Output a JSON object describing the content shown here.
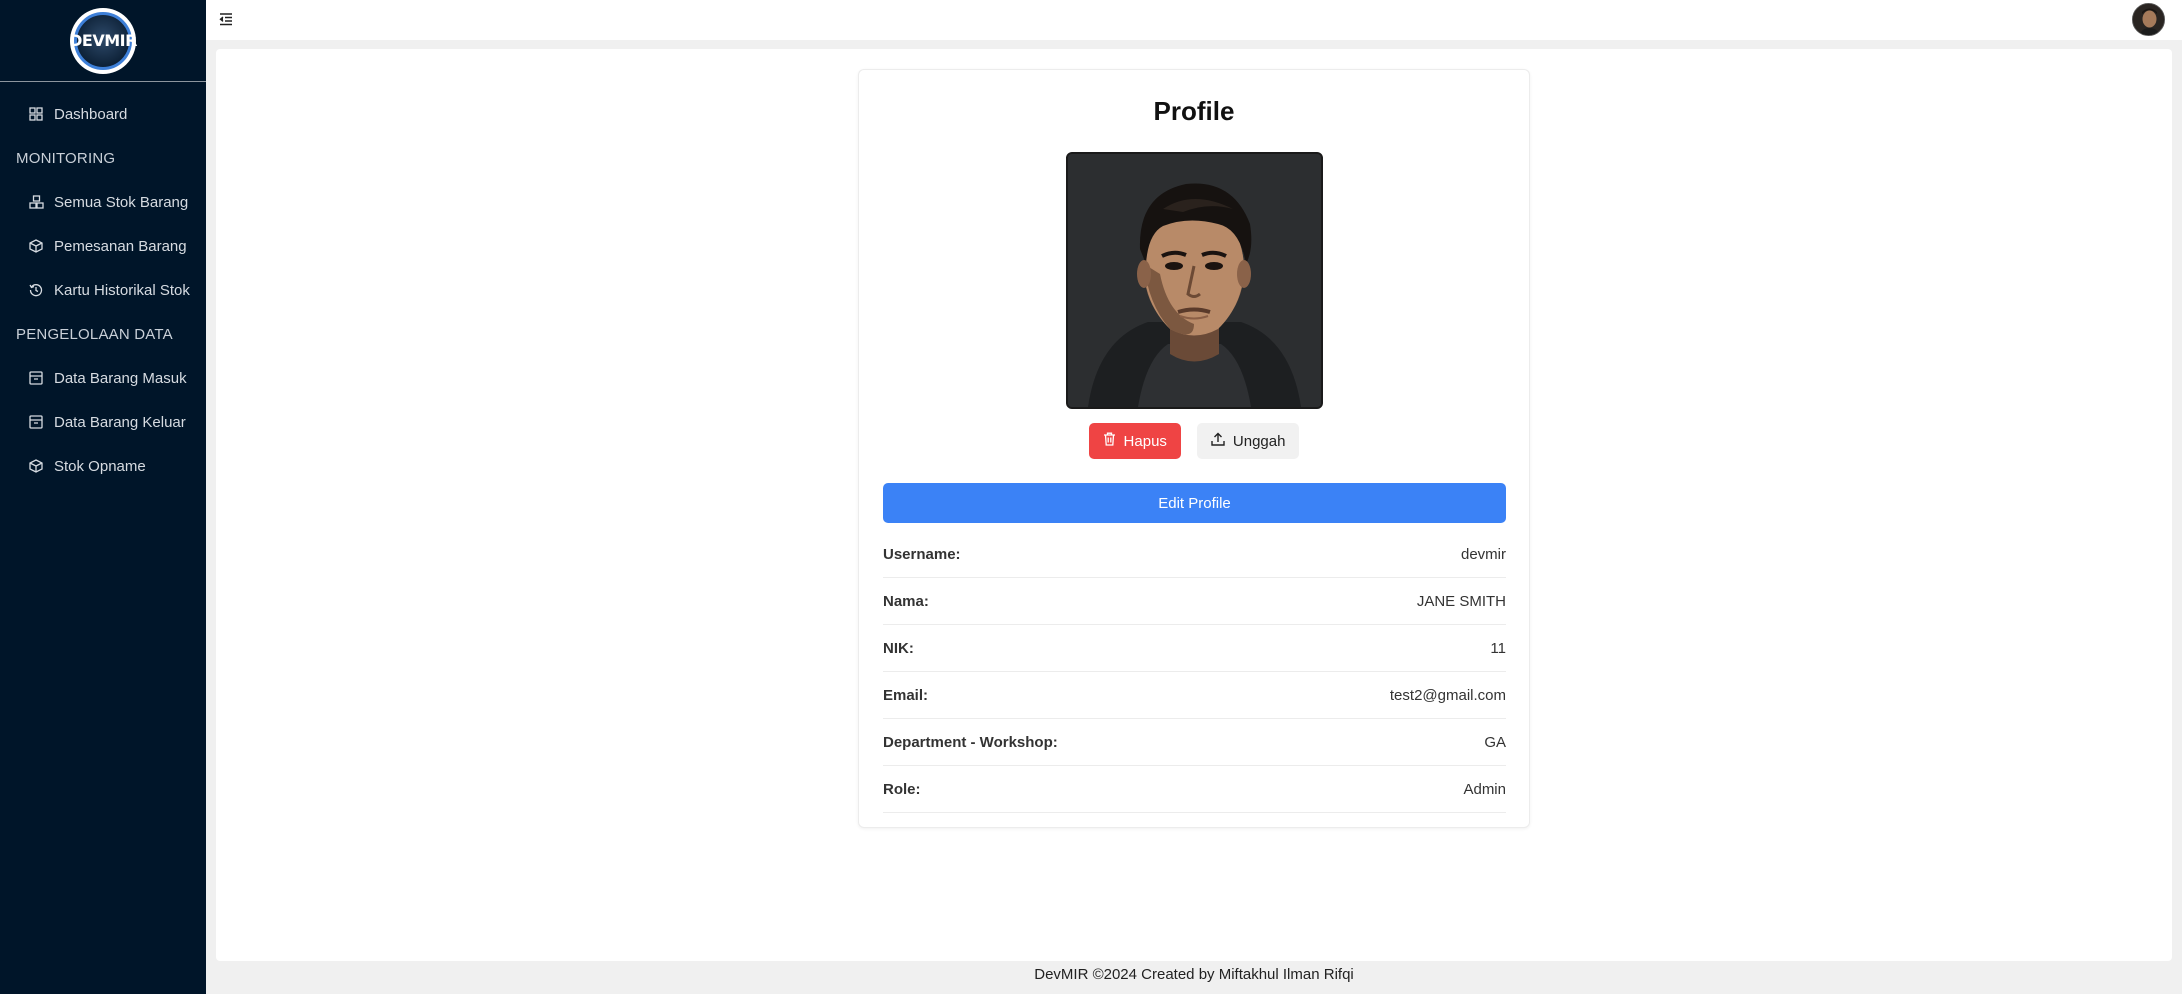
{
  "sidebar": {
    "logo_text": "DEVMIR",
    "items": [
      {
        "label": "Dashboard",
        "icon": "dashboard-icon"
      },
      {
        "group": "MONITORING"
      },
      {
        "label": "Semua Stok Barang",
        "icon": "stock-icon"
      },
      {
        "label": "Pemesanan Barang",
        "icon": "box-icon"
      },
      {
        "label": "Kartu Historikal Stok",
        "icon": "history-icon"
      },
      {
        "group": "PENGELOLAAN DATA"
      },
      {
        "label": "Data Barang Masuk",
        "icon": "inbox-icon"
      },
      {
        "label": "Data Barang Keluar",
        "icon": "outbox-icon"
      },
      {
        "label": "Stok Opname",
        "icon": "box-icon"
      }
    ]
  },
  "header": {
    "toggle_icon": "menu-fold-icon",
    "avatar_icon": "user-avatar"
  },
  "profile": {
    "title": "Profile",
    "delete_label": "Hapus",
    "upload_label": "Unggah",
    "edit_label": "Edit Profile",
    "fields": [
      {
        "key": "Username:",
        "value": "devmir"
      },
      {
        "key": "Nama:",
        "value": "JANE SMITH"
      },
      {
        "key": "NIK:",
        "value": "11"
      },
      {
        "key": "Email:",
        "value": "test2@gmail.com"
      },
      {
        "key": "Department - Workshop:",
        "value": "GA"
      },
      {
        "key": "Role:",
        "value": "Admin"
      }
    ]
  },
  "footer": {
    "text": "DevMIR ©2024 Created by Miftakhul Ilman Rifqi"
  },
  "colors": {
    "sidebar_bg": "#001529",
    "primary": "#3b82f6",
    "danger": "#ef4444"
  }
}
